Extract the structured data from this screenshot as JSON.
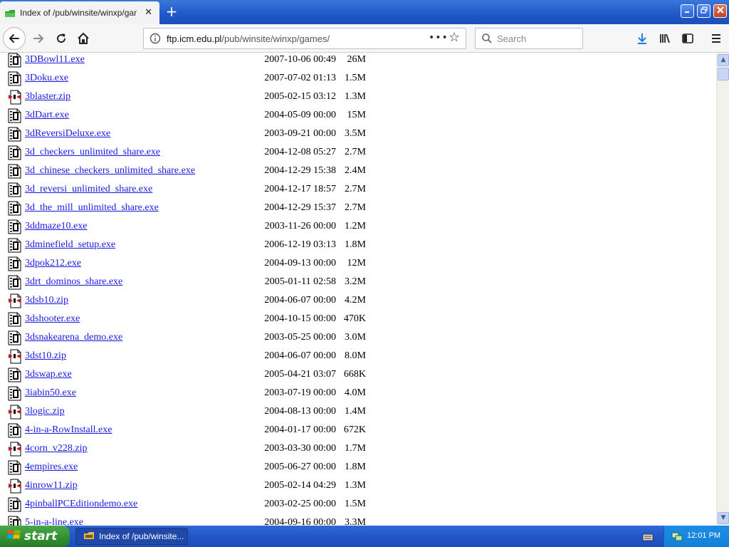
{
  "browser": {
    "tab_title": "Index of /pub/winsite/winxp/games/",
    "tab_close": "✕",
    "new_tab": "+",
    "url_host": "ftp.icm.edu.pl",
    "url_path": "/pub/winsite/winxp/games/",
    "url_more": "•••",
    "search_placeholder": "Search"
  },
  "files": [
    {
      "name": "3DBowl11.exe",
      "date": "2007-10-06 00:49",
      "size": "26M",
      "type": "exe"
    },
    {
      "name": "3Doku.exe",
      "date": "2007-07-02 01:13",
      "size": "1.5M",
      "type": "exe"
    },
    {
      "name": "3blaster.zip",
      "date": "2005-02-15 03:12",
      "size": "1.3M",
      "type": "zip"
    },
    {
      "name": "3dDart.exe",
      "date": "2004-05-09 00:00",
      "size": "15M",
      "type": "exe"
    },
    {
      "name": "3dReversiDeluxe.exe",
      "date": "2003-09-21 00:00",
      "size": "3.5M",
      "type": "exe"
    },
    {
      "name": "3d_checkers_unlimited_share.exe",
      "date": "2004-12-08 05:27",
      "size": "2.7M",
      "type": "exe"
    },
    {
      "name": "3d_chinese_checkers_unlimited_share.exe",
      "date": "2004-12-29 15:38",
      "size": "2.4M",
      "type": "exe"
    },
    {
      "name": "3d_reversi_unlimited_share.exe",
      "date": "2004-12-17 18:57",
      "size": "2.7M",
      "type": "exe"
    },
    {
      "name": "3d_the_mill_unlimited_share.exe",
      "date": "2004-12-29 15:37",
      "size": "2.7M",
      "type": "exe"
    },
    {
      "name": "3ddmaze10.exe",
      "date": "2003-11-26 00:00",
      "size": "1.2M",
      "type": "exe"
    },
    {
      "name": "3dminefield_setup.exe",
      "date": "2006-12-19 03:13",
      "size": "1.8M",
      "type": "exe"
    },
    {
      "name": "3dpok212.exe",
      "date": "2004-09-13 00:00",
      "size": "12M",
      "type": "exe"
    },
    {
      "name": "3drt_dominos_share.exe",
      "date": "2005-01-11 02:58",
      "size": "3.2M",
      "type": "exe"
    },
    {
      "name": "3dsb10.zip",
      "date": "2004-06-07 00:00",
      "size": "4.2M",
      "type": "zip"
    },
    {
      "name": "3dshooter.exe",
      "date": "2004-10-15 00:00",
      "size": "470K",
      "type": "exe"
    },
    {
      "name": "3dsnakearena_demo.exe",
      "date": "2003-05-25 00:00",
      "size": "3.0M",
      "type": "exe"
    },
    {
      "name": "3dst10.zip",
      "date": "2004-06-07 00:00",
      "size": "8.0M",
      "type": "zip"
    },
    {
      "name": "3dswap.exe",
      "date": "2005-04-21 03:07",
      "size": "668K",
      "type": "exe"
    },
    {
      "name": "3iabin50.exe",
      "date": "2003-07-19 00:00",
      "size": "4.0M",
      "type": "exe"
    },
    {
      "name": "3logic.zip",
      "date": "2004-08-13 00:00",
      "size": "1.4M",
      "type": "zip"
    },
    {
      "name": "4-in-a-RowInstall.exe",
      "date": "2004-01-17 00:00",
      "size": "672K",
      "type": "exe"
    },
    {
      "name": "4corn_v228.zip",
      "date": "2003-03-30 00:00",
      "size": "1.7M",
      "type": "zip"
    },
    {
      "name": "4empires.exe",
      "date": "2005-06-27 00:00",
      "size": "1.8M",
      "type": "exe"
    },
    {
      "name": "4inrow11.zip",
      "date": "2005-02-14 04:29",
      "size": "1.3M",
      "type": "zip"
    },
    {
      "name": "4pinballPCEditiondemo.exe",
      "date": "2003-02-25 00:00",
      "size": "1.5M",
      "type": "exe"
    },
    {
      "name": "5-in-a-line.exe",
      "date": "2004-09-16 00:00",
      "size": "3.3M",
      "type": "exe"
    }
  ],
  "taskbar": {
    "start_label": "start",
    "window_label": "Index of /pub/winsite...",
    "clock": "12:01 PM"
  },
  "colors": {
    "link": "#1a1ae0",
    "taskbar": "#2457c8",
    "start": "#2f8f2f"
  }
}
